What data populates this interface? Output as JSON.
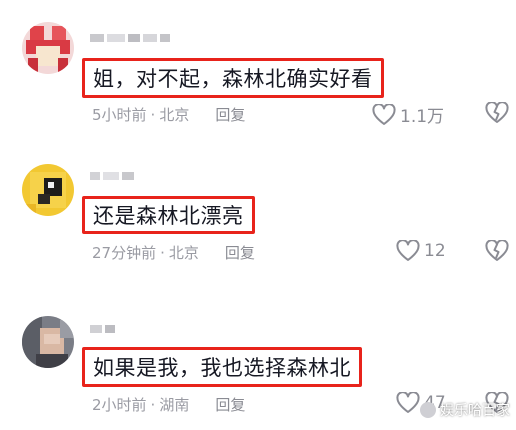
{
  "comments": [
    {
      "text": "姐，对不起，森林北确实好看",
      "time": "5小时前",
      "separator": "·",
      "location": "北京",
      "reply_label": "回复",
      "likes": "1.1万"
    },
    {
      "text": "还是森林北漂亮",
      "time": "27分钟前",
      "separator": "·",
      "location": "北京",
      "reply_label": "回复",
      "likes": "12"
    },
    {
      "text": "如果是我，我也选择森林北",
      "time": "2小时前",
      "separator": "·",
      "location": "湖南",
      "reply_label": "回复",
      "likes": "47"
    }
  ],
  "watermark": {
    "text": "娱乐哈百家"
  },
  "colors": {
    "highlight_border": "#e8231b",
    "meta_text": "#9a9ba3"
  },
  "icons": {
    "like": "heart-outline-icon",
    "dislike": "broken-heart-icon"
  }
}
